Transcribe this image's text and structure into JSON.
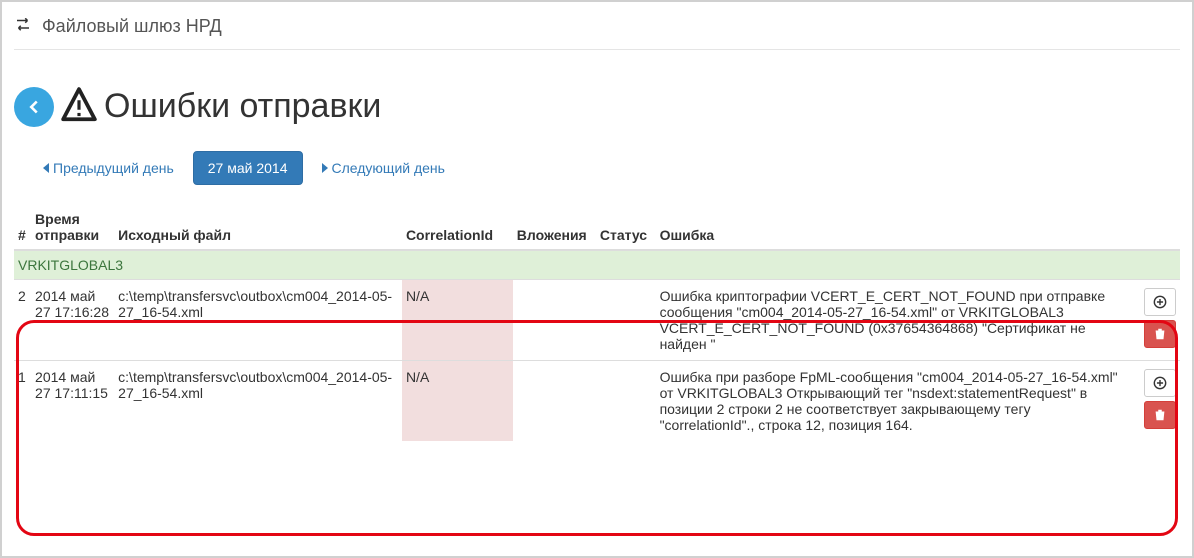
{
  "header": {
    "brand": "Файловый шлюз НРД"
  },
  "page": {
    "title": "Ошибки отправки"
  },
  "dateNav": {
    "prev": "Предыдущий день",
    "current": "27 май 2014",
    "next": "Следующий день"
  },
  "columns": {
    "num": "#",
    "time": "Время отправки",
    "file": "Исходный файл",
    "corr": "CorrelationId",
    "attach": "Вложения",
    "status": "Статус",
    "err": "Ошибка"
  },
  "group": {
    "label": "VRKITGLOBAL3"
  },
  "rows": [
    {
      "num": "2",
      "time": "2014 май 27 17:16:28",
      "file": "c:\\temp\\transfersvc\\outbox\\cm004_2014-05-27_16-54.xml",
      "corr": "N/A",
      "attach": "",
      "status": "",
      "err": "Ошибка криптографии VCERT_E_CERT_NOT_FOUND при отправке сообщения \"cm004_2014-05-27_16-54.xml\" от VRKITGLOBAL3 VCERT_E_CERT_NOT_FOUND (0x37654364868) \"Сертификат не найден \""
    },
    {
      "num": "1",
      "time": "2014 май 27 17:11:15",
      "file": "c:\\temp\\transfersvc\\outbox\\cm004_2014-05-27_16-54.xml",
      "corr": "N/A",
      "attach": "",
      "status": "",
      "err": "Ошибка при разборе FpML-сообщения \"cm004_2014-05-27_16-54.xml\" от VRKITGLOBAL3 Открывающий тег \"nsdext:statementRequest\" в позиции 2 строки 2 не соответствует закрывающему тегу \"correlationId\"., строка 12, позиция 164."
    }
  ]
}
